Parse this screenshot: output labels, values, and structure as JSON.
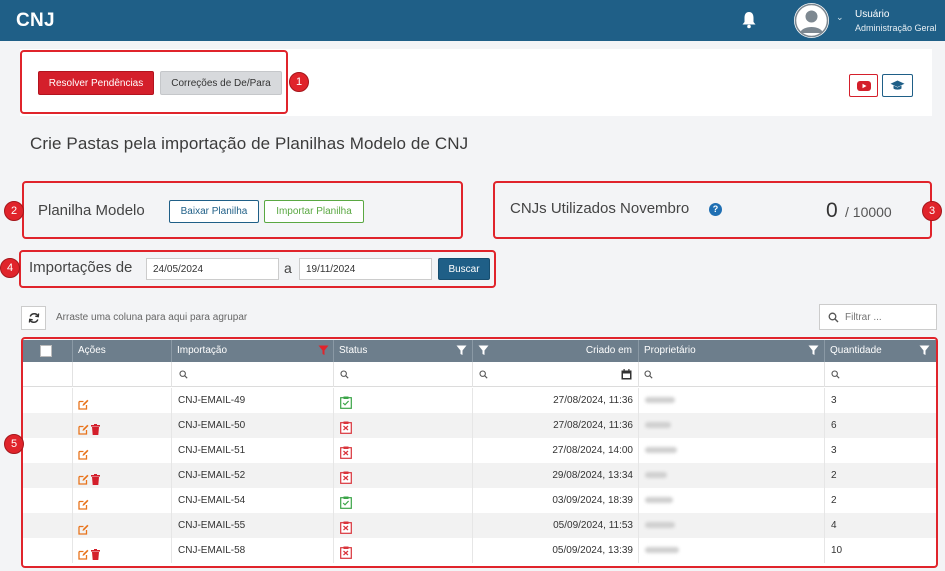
{
  "header": {
    "brand": "CNJ",
    "user_name": "Usuário",
    "user_role": "Administração Geral"
  },
  "toolbar": {
    "resolver_label": "Resolver Pendências",
    "correcoes_label": "Correções de De/Para"
  },
  "page_title": "Crie Pastas pela importação de Planilhas Modelo de CNJ",
  "planilha": {
    "label": "Planilha Modelo",
    "baixar_label": "Baixar Planilha",
    "importar_label": "Importar Planilha"
  },
  "cnj_usage": {
    "label": "CNJs Utilizados Novembro",
    "used": "0",
    "limit": "/ 10000"
  },
  "import_filter": {
    "label": "Importações de",
    "date_from": "24/05/2024",
    "separator": "a",
    "date_to": "19/11/2024",
    "buscar_label": "Buscar"
  },
  "grid_toolbar": {
    "group_hint": "Arraste uma coluna para aqui para agrupar",
    "filter_placeholder": "Filtrar ..."
  },
  "table": {
    "columns": [
      "Ações",
      "Importação",
      "Status",
      "Criado em",
      "Proprietário",
      "Quantidade"
    ],
    "rows": [
      {
        "importacao": "CNJ-EMAIL-49",
        "status": "ok",
        "criado_em": "27/08/2024, 11:36",
        "quantidade": "3",
        "can_delete": false
      },
      {
        "importacao": "CNJ-EMAIL-50",
        "status": "error",
        "criado_em": "27/08/2024, 11:36",
        "quantidade": "6",
        "can_delete": true
      },
      {
        "importacao": "CNJ-EMAIL-51",
        "status": "error",
        "criado_em": "27/08/2024, 14:00",
        "quantidade": "3",
        "can_delete": false
      },
      {
        "importacao": "CNJ-EMAIL-52",
        "status": "error",
        "criado_em": "29/08/2024, 13:34",
        "quantidade": "2",
        "can_delete": true
      },
      {
        "importacao": "CNJ-EMAIL-54",
        "status": "ok",
        "criado_em": "03/09/2024, 18:39",
        "quantidade": "2",
        "can_delete": false
      },
      {
        "importacao": "CNJ-EMAIL-55",
        "status": "error",
        "criado_em": "05/09/2024, 11:53",
        "quantidade": "4",
        "can_delete": false
      },
      {
        "importacao": "CNJ-EMAIL-58",
        "status": "error",
        "criado_em": "05/09/2024, 13:39",
        "quantidade": "10",
        "can_delete": true
      }
    ]
  },
  "annotations": [
    "1",
    "2",
    "3",
    "4",
    "5"
  ],
  "colors": {
    "topbar": "#1f5f87",
    "danger": "#d41f2b",
    "success": "#5aa842",
    "table_header": "#6d7e8c",
    "annotation": "#e0242b",
    "edit_icon": "#e8741c"
  }
}
